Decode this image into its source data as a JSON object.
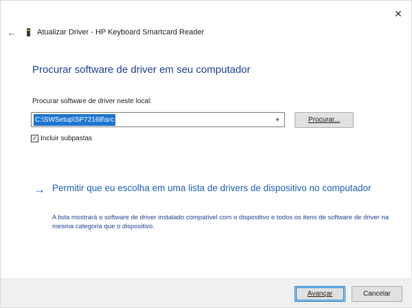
{
  "window": {
    "close_glyph": "✕",
    "back_glyph": "←",
    "title": "Atualizar Driver - HP Keyboard Smartcard Reader"
  },
  "main": {
    "heading": "Procurar software de driver em seu computador",
    "path_label": "Procurar software de driver neste local:",
    "path_value": "C:\\SWSetup\\SP72168\\src",
    "browse_label": "Procurar...",
    "include_subfolders": {
      "label": "Incluir subpastas",
      "checked": true,
      "check_glyph": "✓"
    },
    "link": {
      "arrow_glyph": "→",
      "title": "Permitir que eu escolha em uma lista de drivers de dispositivo no computador",
      "description": "A lista mostrará o software de driver instalado compatível com o dispositivo e todos os itens de software de driver na mesma categoria que o dispositivo."
    }
  },
  "footer": {
    "next_label": "Avançar",
    "cancel_label": "Cancelar"
  },
  "colors": {
    "heading": "#1c3f91",
    "link": "#1c5fb5",
    "selection": "#1e74d0",
    "default_button_border": "#0078d7"
  },
  "icons": {
    "close": "close-icon",
    "back": "back-arrow-icon",
    "device": "smartcard-reader-icon",
    "link_arrow": "arrow-right-icon",
    "dropdown": "chevron-down-icon",
    "checkbox": "checkmark-icon"
  }
}
